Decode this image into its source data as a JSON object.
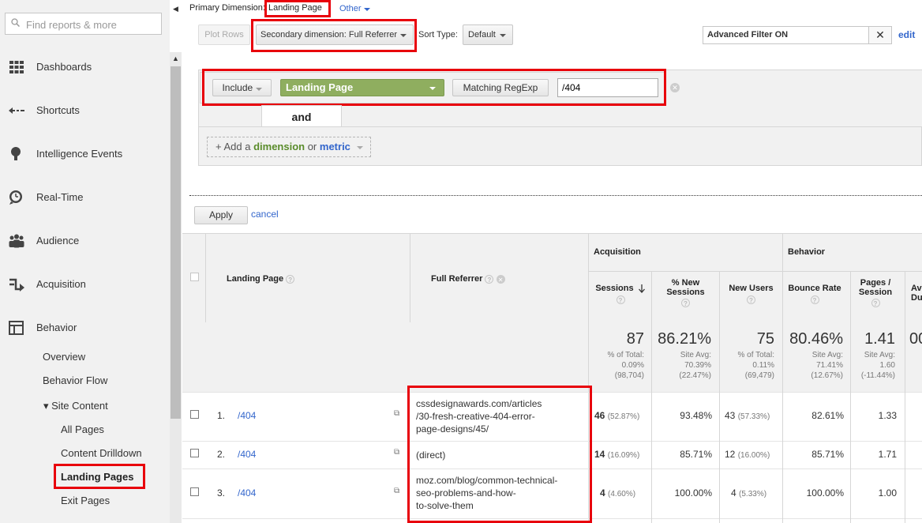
{
  "sidebar": {
    "search_placeholder": "Find reports & more",
    "nav": [
      {
        "label": "Dashboards",
        "icon": "dashboard-grid-icon"
      },
      {
        "label": "Shortcuts",
        "icon": "shortcut-arrow-icon"
      },
      {
        "label": "Intelligence Events",
        "icon": "lightbulb-icon"
      },
      {
        "label": "Real-Time",
        "icon": "clock-icon"
      },
      {
        "label": "Audience",
        "icon": "people-icon"
      },
      {
        "label": "Acquisition",
        "icon": "acquisition-arrows-icon"
      },
      {
        "label": "Behavior",
        "icon": "behavior-layout-icon"
      }
    ],
    "behavior_sub": {
      "overview": "Overview",
      "behavior_flow": "Behavior Flow",
      "site_content": "▾ Site Content",
      "all_pages": "All Pages",
      "content_drilldown": "Content Drilldown",
      "landing_pages": "Landing Pages",
      "exit_pages": "Exit Pages"
    }
  },
  "header": {
    "primary_dimension_label": "Primary Dimension:",
    "primary_dimension_value": "Landing Page",
    "other_label": "Other"
  },
  "toolbar": {
    "plot_rows": "Plot Rows",
    "secondary_dimension": "Secondary dimension: Full Referrer",
    "sort_type_label": "Sort Type:",
    "sort_type_value": "Default",
    "advanced_filter": "Advanced Filter ON",
    "edit": "edit"
  },
  "filter": {
    "include": "Include",
    "dimension": "Landing Page",
    "match_type": "Matching RegExp",
    "value": "/404",
    "and_label": "and",
    "add_prefix": "+ Add a ",
    "add_dimension": "dimension",
    "add_or": " or ",
    "add_metric": "metric",
    "apply": "Apply",
    "cancel": "cancel"
  },
  "table": {
    "group_acquisition": "Acquisition",
    "group_behavior": "Behavior",
    "col_landing_page": "Landing Page",
    "col_full_referrer": "Full Referrer",
    "col_sessions": "Sessions",
    "col_new_sessions_1": "% New",
    "col_new_sessions_2": "Sessions",
    "col_new_users": "New Users",
    "col_bounce_rate": "Bounce Rate",
    "col_pages_1": "Pages /",
    "col_pages_2": "Session",
    "col_avg_1": "Av",
    "col_avg_2": "Du",
    "totals": {
      "sessions": "87",
      "sessions_sub1": "% of Total:",
      "sessions_sub2": "0.09%",
      "sessions_sub3": "(98,704)",
      "new_sessions": "86.21%",
      "new_sessions_sub1": "Site Avg:",
      "new_sessions_sub2": "70.39%",
      "new_sessions_sub3": "(22.47%)",
      "new_users": "75",
      "new_users_sub1": "% of Total:",
      "new_users_sub2": "0.11%",
      "new_users_sub3": "(69,479)",
      "bounce_rate": "80.46%",
      "bounce_rate_sub1": "Site Avg:",
      "bounce_rate_sub2": "71.41%",
      "bounce_rate_sub3": "(12.67%)",
      "pages": "1.41",
      "pages_sub1": "Site Avg:",
      "pages_sub2": "1.60",
      "pages_sub3": "(-11.44%)",
      "avg_partial": "00"
    },
    "rows": [
      {
        "num": "1.",
        "page": "/404",
        "ref1": "cssdesignawards.com/articles",
        "ref2": "/30-fresh-creative-404-error-",
        "ref3": "page-designs/45/",
        "sessions": "46",
        "sessions_pct": "(52.87%)",
        "new_sessions": "93.48%",
        "new_users": "43",
        "new_users_pct": "(57.33%)",
        "bounce": "82.61%",
        "pages": "1.33"
      },
      {
        "num": "2.",
        "page": "/404",
        "ref1": "(direct)",
        "ref2": "",
        "ref3": "",
        "sessions": "14",
        "sessions_pct": "(16.09%)",
        "new_sessions": "85.71%",
        "new_users": "12",
        "new_users_pct": "(16.00%)",
        "bounce": "85.71%",
        "pages": "1.71"
      },
      {
        "num": "3.",
        "page": "/404",
        "ref1": "moz.com/blog/common-technical-",
        "ref2": "seo-problems-and-how-",
        "ref3": "to-solve-them",
        "sessions": "4",
        "sessions_pct": "(4.60%)",
        "new_sessions": "100.00%",
        "new_users": "4",
        "new_users_pct": "(5.33%)",
        "bounce": "100.00%",
        "pages": "1.00"
      }
    ]
  },
  "colors": {
    "highlight": "#e8000b",
    "link": "#3366cc",
    "dimension_green": "#8fae5f"
  }
}
